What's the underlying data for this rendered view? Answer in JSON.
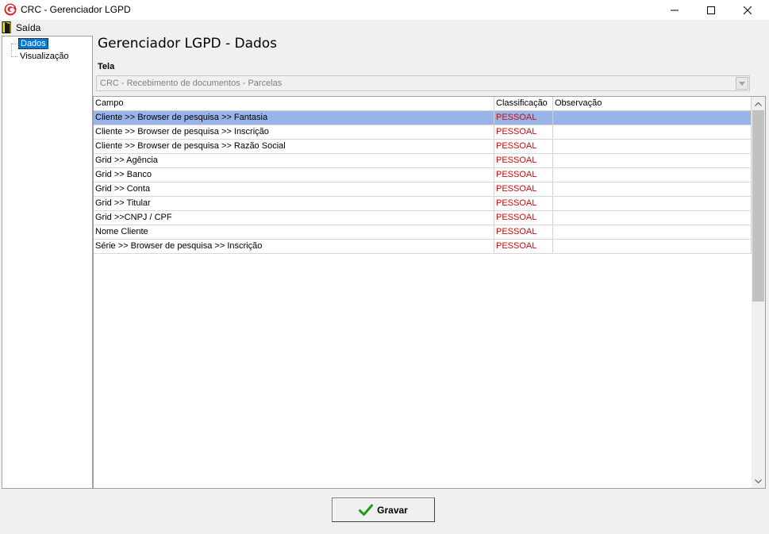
{
  "window": {
    "title": "CRC - Gerenciador LGPD",
    "icon": "app-logo-icon",
    "controls": [
      "minimize-icon",
      "maximize-icon",
      "close-icon"
    ]
  },
  "menu": {
    "exit_label": "Saída",
    "exit_icon": "door-exit-icon"
  },
  "tree": {
    "items": [
      {
        "label": "Dados",
        "selected": true
      },
      {
        "label": "Visualização",
        "selected": false
      }
    ]
  },
  "main": {
    "title": "Gerenciador LGPD - Dados",
    "screen_label": "Tela",
    "screen_value": "CRC - Recebimento de documentos - Parcelas"
  },
  "grid": {
    "columns": [
      "Campo",
      "Classificação",
      "Observação"
    ],
    "rows": [
      {
        "field": "Cliente >> Browser de pesquisa >> Fantasia",
        "classification": "PESSOAL",
        "observation": ""
      },
      {
        "field": "Cliente >> Browser de pesquisa >> Inscrição",
        "classification": "PESSOAL",
        "observation": ""
      },
      {
        "field": "Cliente >> Browser de pesquisa >> Razão Social",
        "classification": "PESSOAL",
        "observation": ""
      },
      {
        "field": "Grid >> Agência",
        "classification": "PESSOAL",
        "observation": ""
      },
      {
        "field": "Grid >> Banco",
        "classification": "PESSOAL",
        "observation": ""
      },
      {
        "field": "Grid >> Conta",
        "classification": "PESSOAL",
        "observation": ""
      },
      {
        "field": "Grid >> Titular",
        "classification": "PESSOAL",
        "observation": ""
      },
      {
        "field": "Grid >>CNPJ / CPF",
        "classification": "PESSOAL",
        "observation": ""
      },
      {
        "field": "Nome Cliente",
        "classification": "PESSOAL",
        "observation": ""
      },
      {
        "field": "Série >> Browser de pesquisa >> Inscrição",
        "classification": "PESSOAL",
        "observation": ""
      }
    ]
  },
  "footer": {
    "save_label": "Gravar",
    "save_icon": "checkmark-icon"
  },
  "colors": {
    "selection": "#99b4e8",
    "classification_text": "#e00000",
    "tree_selection": "#0078d7"
  }
}
